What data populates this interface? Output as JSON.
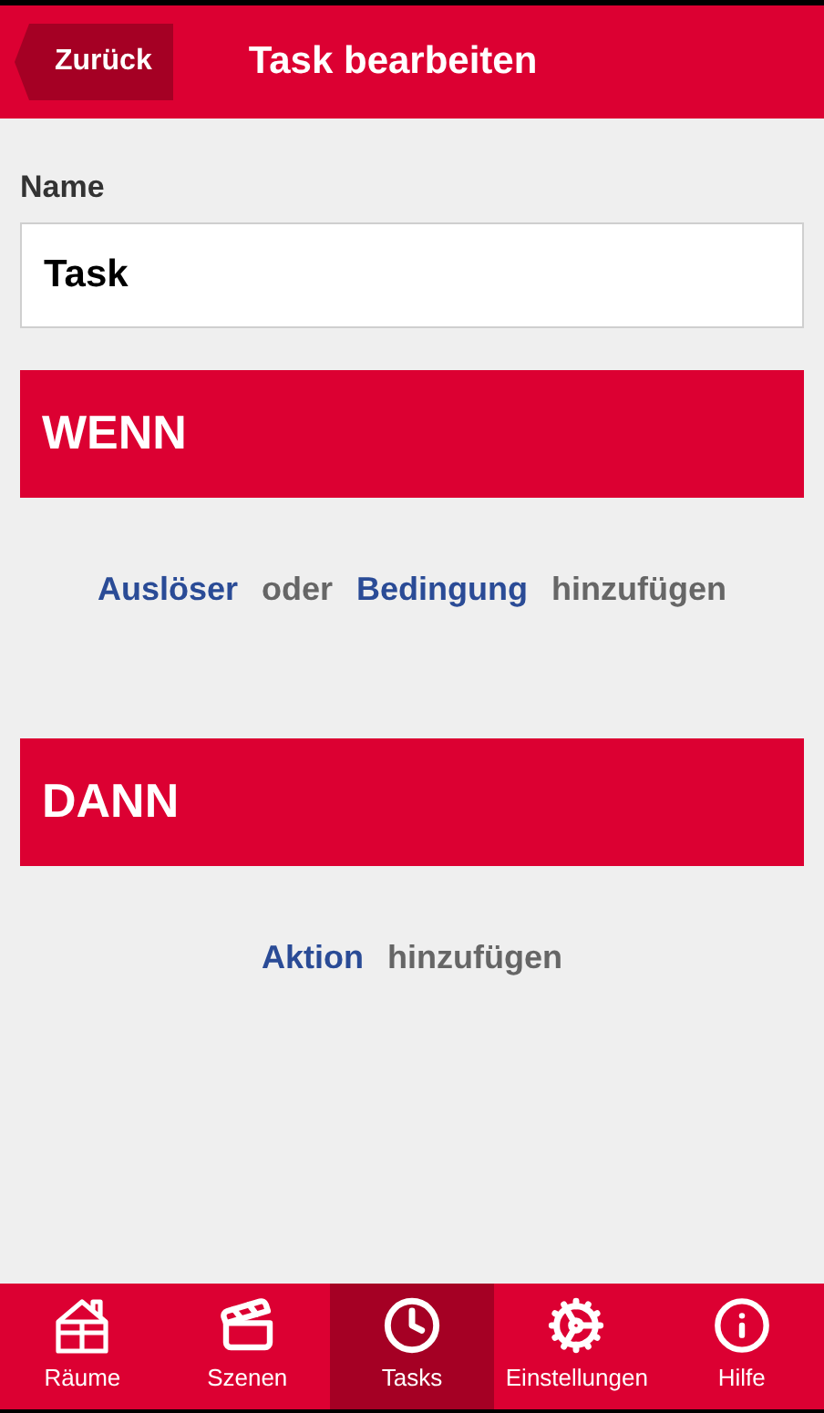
{
  "header": {
    "back": "Zurück",
    "title": "Task bearbeiten"
  },
  "name_field": {
    "label": "Name",
    "value": "Task"
  },
  "sections": [
    {
      "title": "WENN",
      "add_line": [
        {
          "kind": "link",
          "text": "Auslöser"
        },
        {
          "kind": "text",
          "text": "oder"
        },
        {
          "kind": "link",
          "text": "Bedingung"
        },
        {
          "kind": "text",
          "text": "hinzufügen"
        }
      ]
    },
    {
      "title": "DANN",
      "add_line": [
        {
          "kind": "link",
          "text": "Aktion"
        },
        {
          "kind": "text",
          "text": "hinzufügen"
        }
      ]
    }
  ],
  "tab_bar": [
    {
      "kind": "rooms",
      "label": "Räume",
      "selected": false
    },
    {
      "kind": "scenes",
      "label": "Szenen",
      "selected": false
    },
    {
      "kind": "tasks",
      "label": "Tasks",
      "selected": true
    },
    {
      "kind": "settings",
      "label": "Einstellungen",
      "selected": false
    },
    {
      "kind": "help",
      "label": "Hilfe",
      "selected": false
    }
  ]
}
